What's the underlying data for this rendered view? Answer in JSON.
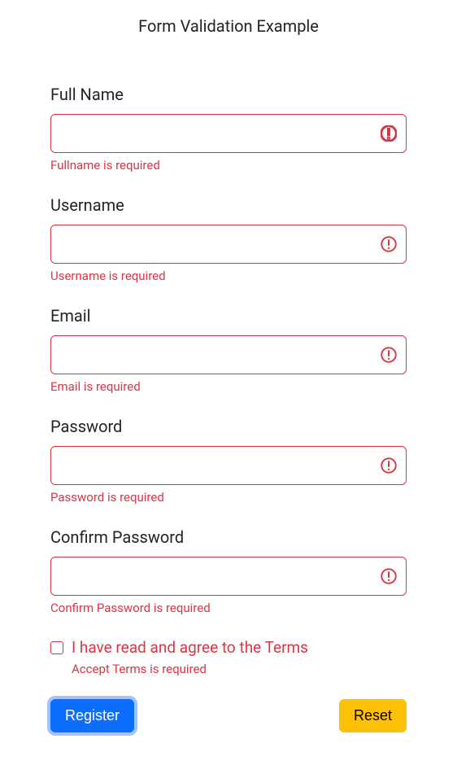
{
  "title": "Form Validation Example",
  "fields": {
    "fullname": {
      "label": "Full Name",
      "value": "",
      "error": "Fullname is required"
    },
    "username": {
      "label": "Username",
      "value": "",
      "error": "Username is required"
    },
    "email": {
      "label": "Email",
      "value": "",
      "error": "Email is required"
    },
    "password": {
      "label": "Password",
      "value": "",
      "error": "Password is required"
    },
    "confirm_password": {
      "label": "Confirm Password",
      "value": "",
      "error": "Confirm Password is required"
    }
  },
  "terms": {
    "label": "I have read and agree to the Terms",
    "checked": false,
    "error": "Accept Terms is required"
  },
  "buttons": {
    "register": "Register",
    "reset": "Reset"
  },
  "colors": {
    "error": "#dc3545",
    "primary": "#0d6efd",
    "warning": "#ffc107"
  }
}
